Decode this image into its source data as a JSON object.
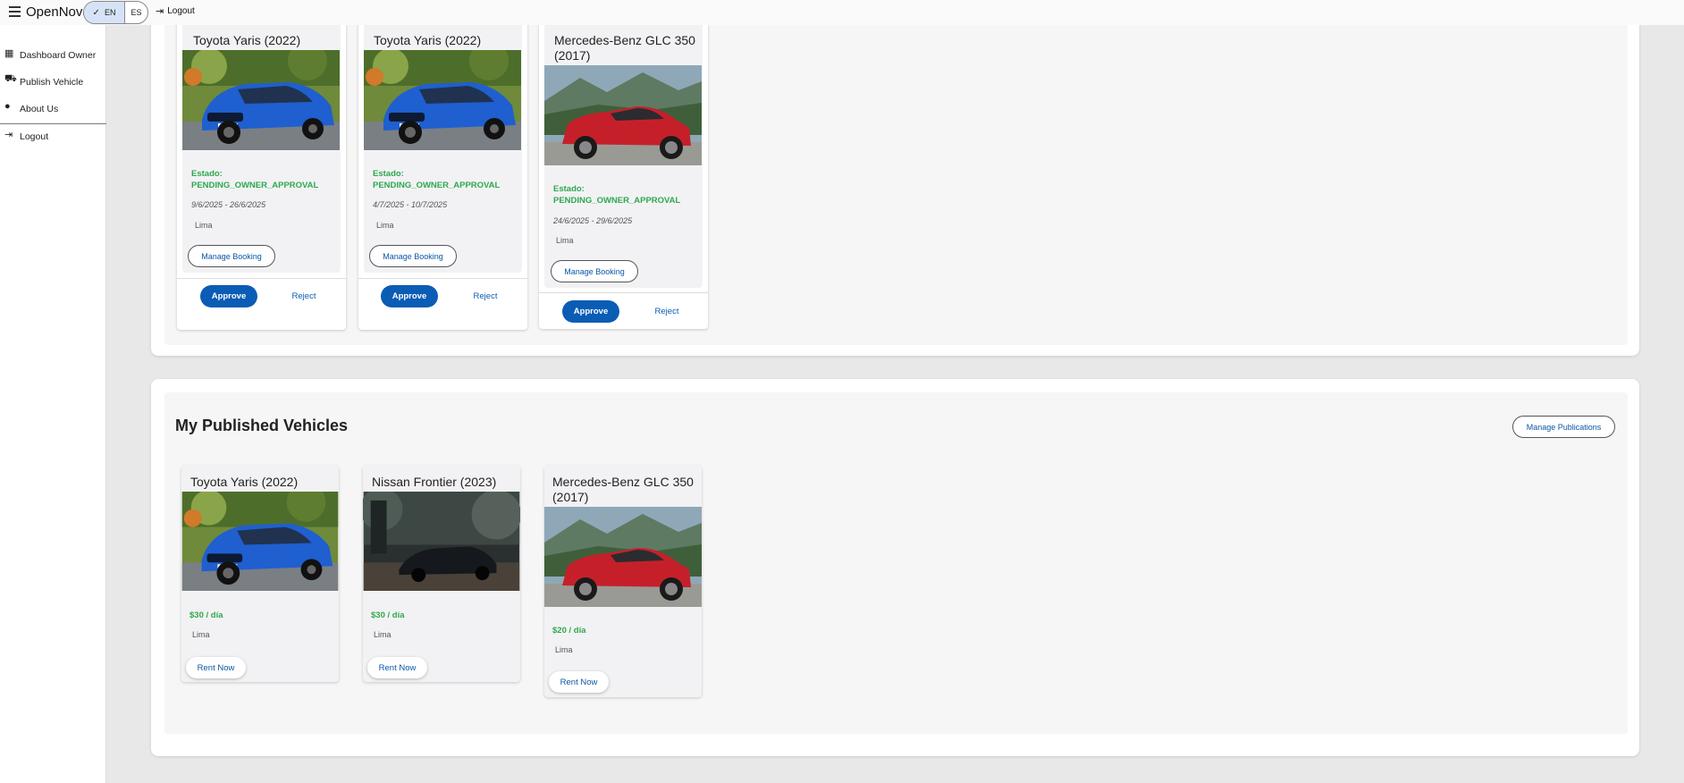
{
  "header": {
    "app_title": "OpenNova",
    "menu_icon": "menu-icon",
    "lang": {
      "en": "EN",
      "es": "ES",
      "selected": "EN"
    },
    "logout_label": "Logout"
  },
  "sidebar": {
    "items": [
      {
        "label": "Dashboard Owner",
        "icon": "dashboard-icon"
      },
      {
        "label": "Publish Vehicle",
        "icon": "car-icon"
      },
      {
        "label": "About Us",
        "icon": "info-icon"
      },
      {
        "label": "Logout",
        "icon": "logout-icon"
      }
    ]
  },
  "bookings": {
    "cards": [
      {
        "title": "Toyota Yaris (2022)",
        "status_label": "Estado:",
        "status": "PENDING_OWNER_APPROVAL",
        "dates": "9/6/2025 - 26/6/2025",
        "city": "Lima",
        "manage_label": "Manage Booking",
        "approve_label": "Approve",
        "reject_label": "Reject",
        "image": "blue-car"
      },
      {
        "title": "Toyota Yaris (2022)",
        "status_label": "Estado:",
        "status": "PENDING_OWNER_APPROVAL",
        "dates": "4/7/2025 - 10/7/2025",
        "city": "Lima",
        "manage_label": "Manage Booking",
        "approve_label": "Approve",
        "reject_label": "Reject",
        "image": "blue-car"
      },
      {
        "title": "Mercedes-Benz GLC 350 (2017)",
        "status_label": "Estado:",
        "status": "PENDING_OWNER_APPROVAL",
        "dates": "24/6/2025 - 29/6/2025",
        "city": "Lima",
        "manage_label": "Manage Booking",
        "approve_label": "Approve",
        "reject_label": "Reject",
        "image": "red-suv"
      }
    ]
  },
  "published": {
    "title": "My Published Vehicles",
    "manage_label": "Manage Publications",
    "cards": [
      {
        "title": "Toyota Yaris (2022)",
        "price": "$30 / día",
        "city": "Lima",
        "rent_label": "Rent Now",
        "image": "blue-car"
      },
      {
        "title": "Nissan Frontier (2023)",
        "price": "$30 / día",
        "city": "Lima",
        "rent_label": "Rent Now",
        "image": "dark-car"
      },
      {
        "title": "Mercedes-Benz GLC 350 (2017)",
        "price": "$20 / día",
        "city": "Lima",
        "rent_label": "Rent Now",
        "image": "red-suv"
      }
    ]
  },
  "colors": {
    "accent": "#0b5cb5",
    "status_green": "#2fa84f",
    "lang_selected": "#d6e3f6"
  }
}
